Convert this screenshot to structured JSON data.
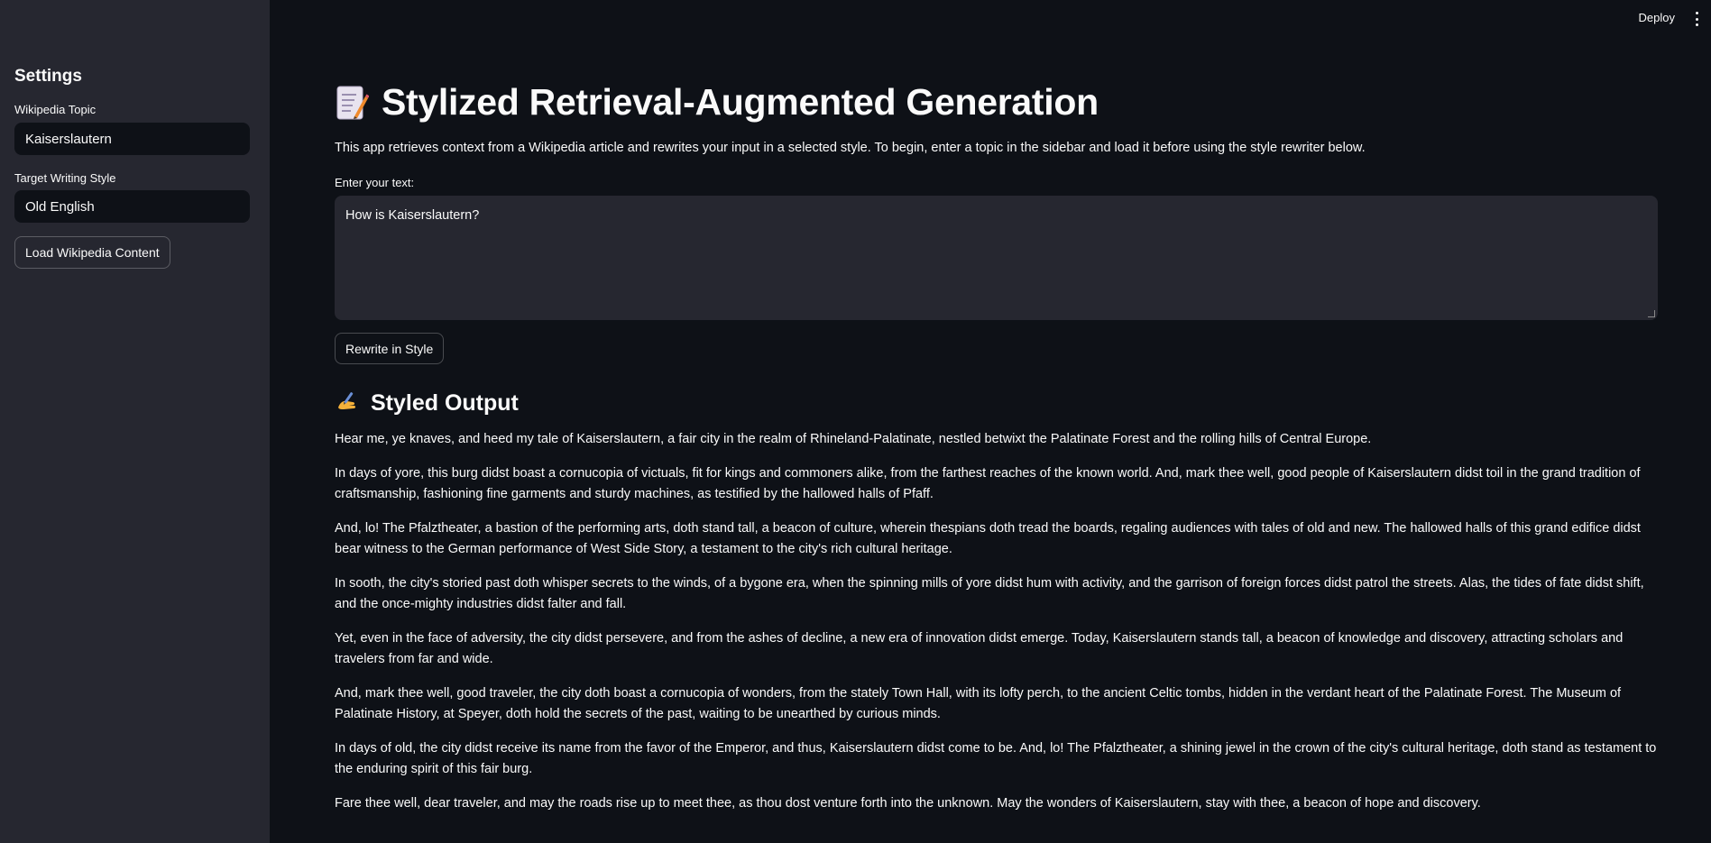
{
  "header": {
    "deploy_label": "Deploy",
    "menu_icon": "vertical-dots-icon"
  },
  "sidebar": {
    "title": "Settings",
    "topic_label": "Wikipedia Topic",
    "topic_value": "Kaiserslautern",
    "style_label": "Target Writing Style",
    "style_value": "Old English",
    "load_button": "Load Wikipedia Content"
  },
  "main": {
    "title_icon": "memo-icon",
    "title": "Stylized Retrieval-Augmented Generation",
    "intro": "This app retrieves context from a Wikipedia article and rewrites your input in a selected style. To begin, enter a topic in the sidebar and load it before using the style rewriter below.",
    "input_label": "Enter your text:",
    "input_value": "How is Kaiserslautern?",
    "rewrite_button": "Rewrite in Style",
    "output_icon": "writing-hand-icon",
    "output_title": "Styled Output",
    "output_paragraphs": [
      "Hear me, ye knaves, and heed my tale of Kaiserslautern, a fair city in the realm of Rhineland-Palatinate, nestled betwixt the Palatinate Forest and the rolling hills of Central Europe.",
      "In days of yore, this burg didst boast a cornucopia of victuals, fit for kings and commoners alike, from the farthest reaches of the known world. And, mark thee well, good people of Kaiserslautern didst toil in the grand tradition of craftsmanship, fashioning fine garments and sturdy machines, as testified by the hallowed halls of Pfaff.",
      "And, lo! The Pfalztheater, a bastion of the performing arts, doth stand tall, a beacon of culture, wherein thespians doth tread the boards, regaling audiences with tales of old and new. The hallowed halls of this grand edifice didst bear witness to the German performance of West Side Story, a testament to the city's rich cultural heritage.",
      "In sooth, the city's storied past doth whisper secrets to the winds, of a bygone era, when the spinning mills of yore didst hum with activity, and the garrison of foreign forces didst patrol the streets. Alas, the tides of fate didst shift, and the once-mighty industries didst falter and fall.",
      "Yet, even in the face of adversity, the city didst persevere, and from the ashes of decline, a new era of innovation didst emerge. Today, Kaiserslautern stands tall, a beacon of knowledge and discovery, attracting scholars and travelers from far and wide.",
      "And, mark thee well, good traveler, the city doth boast a cornucopia of wonders, from the stately Town Hall, with its lofty perch, to the ancient Celtic tombs, hidden in the verdant heart of the Palatinate Forest. The Museum of Palatinate History, at Speyer, doth hold the secrets of the past, waiting to be unearthed by curious minds.",
      "In days of old, the city didst receive its name from the favor of the Emperor, and thus, Kaiserslautern didst come to be. And, lo! The Pfalztheater, a shining jewel in the crown of the city's cultural heritage, doth stand as testament to the enduring spirit of this fair burg.",
      "Fare thee well, dear traveler, and may the roads rise up to meet thee, as thou dost venture forth into the unknown. May the wonders of Kaiserslautern, stay with thee, a beacon of hope and discovery."
    ]
  },
  "colors": {
    "background": "#0e1117",
    "sidebar": "#262730",
    "text": "#fafafa"
  }
}
